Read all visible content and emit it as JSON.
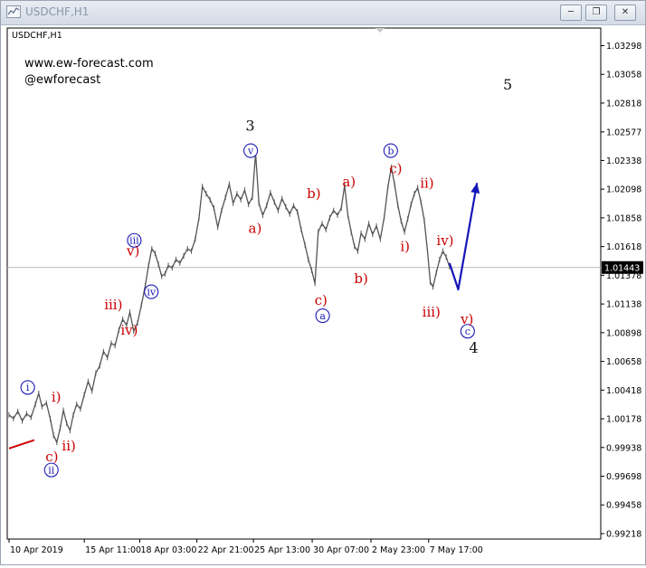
{
  "window": {
    "title": "USDCHF,H1",
    "buttons": [
      "minimize",
      "restore",
      "close"
    ]
  },
  "chart_data": {
    "type": "line",
    "symbol_label": "USDCHF,H1",
    "watermark": [
      "www.ew-forecast.com",
      "@ewforecast"
    ],
    "ylim": [
      0.9918,
      1.034
    ],
    "xlim": [
      0,
      100
    ],
    "y_ticks": [
      "1.03298",
      "1.03058",
      "1.02818",
      "1.02577",
      "1.02338",
      "1.02098",
      "1.01858",
      "1.01618",
      "1.01378",
      "1.01138",
      "1.00898",
      "1.00658",
      "1.00418",
      "1.00178",
      "0.99938",
      "0.99698",
      "0.99458",
      "0.99218"
    ],
    "y_tick_values": [
      1.03298,
      1.03058,
      1.02818,
      1.02577,
      1.02338,
      1.02098,
      1.01858,
      1.01618,
      1.01378,
      1.01138,
      1.00898,
      1.00658,
      1.00418,
      1.00178,
      0.99938,
      0.99698,
      0.99458,
      0.99218
    ],
    "x_ticks": [
      "10 Apr 2019",
      "15 Apr 11:00",
      "18 Apr 03:00",
      "22 Apr 21:00",
      "25 Apr 13:00",
      "30 Apr 07:00",
      "2 May 23:00",
      "7 May 17:00"
    ],
    "x_tick_positions": [
      0,
      13.7,
      23.8,
      34.2,
      44.5,
      55.2,
      65.9,
      76.4
    ],
    "current_price": "1.01443",
    "current_price_value": 1.01443,
    "colors": {
      "price": "#555555",
      "label_red": "#cc0000",
      "label_blue": "#1a1ab4",
      "arrow_blue": "#1616b8",
      "label_black": "#111111",
      "price_box": "#000000"
    },
    "series": [
      {
        "values": [
          [
            0,
            1.0021
          ],
          [
            0.8,
            1.0018
          ],
          [
            1.6,
            1.0024
          ],
          [
            2.4,
            1.0016
          ],
          [
            3.2,
            1.0022
          ],
          [
            4.0,
            1.0019
          ],
          [
            4.8,
            1.003
          ],
          [
            5.4,
            1.0039
          ],
          [
            6.0,
            1.0028
          ],
          [
            6.8,
            1.0031
          ],
          [
            7.5,
            1.0018
          ],
          [
            8.1,
            1.0004
          ],
          [
            8.7,
            0.9998
          ],
          [
            9.3,
            1.001
          ],
          [
            9.9,
            1.0025
          ],
          [
            10.5,
            1.0014
          ],
          [
            11.1,
            1.0008
          ],
          [
            11.7,
            1.0021
          ],
          [
            12.3,
            1.003
          ],
          [
            13.0,
            1.0026
          ],
          [
            13.7,
            1.0038
          ],
          [
            14.4,
            1.0049
          ],
          [
            15.1,
            1.0041
          ],
          [
            15.8,
            1.0056
          ],
          [
            16.5,
            1.0062
          ],
          [
            17.2,
            1.0074
          ],
          [
            17.9,
            1.0069
          ],
          [
            18.6,
            1.0081
          ],
          [
            19.3,
            1.0079
          ],
          [
            20.0,
            1.0092
          ],
          [
            20.7,
            1.0101
          ],
          [
            21.4,
            1.0096
          ],
          [
            22.0,
            1.0107
          ],
          [
            22.7,
            1.0091
          ],
          [
            23.4,
            1.0098
          ],
          [
            24.1,
            1.0113
          ],
          [
            24.8,
            1.0129
          ],
          [
            25.4,
            1.0146
          ],
          [
            26.0,
            1.016
          ],
          [
            26.6,
            1.0156
          ],
          [
            27.2,
            1.0147
          ],
          [
            27.8,
            1.0137
          ],
          [
            28.4,
            1.0139
          ],
          [
            29.0,
            1.0146
          ],
          [
            29.7,
            1.0144
          ],
          [
            30.4,
            1.0151
          ],
          [
            31.1,
            1.0148
          ],
          [
            31.8,
            1.0154
          ],
          [
            32.5,
            1.016
          ],
          [
            33.2,
            1.0158
          ],
          [
            33.9,
            1.0168
          ],
          [
            34.6,
            1.0186
          ],
          [
            35.2,
            1.0212
          ],
          [
            35.9,
            1.0206
          ],
          [
            36.6,
            1.0201
          ],
          [
            37.3,
            1.0194
          ],
          [
            38.0,
            1.0178
          ],
          [
            38.7,
            1.0192
          ],
          [
            39.4,
            1.0203
          ],
          [
            40.1,
            1.0214
          ],
          [
            40.8,
            1.0198
          ],
          [
            41.5,
            1.0206
          ],
          [
            42.2,
            1.0201
          ],
          [
            42.9,
            1.0209
          ],
          [
            43.6,
            1.0197
          ],
          [
            44.3,
            1.0203
          ],
          [
            44.9,
            1.024
          ],
          [
            45.5,
            1.0198
          ],
          [
            46.2,
            1.0188
          ],
          [
            46.9,
            1.0196
          ],
          [
            47.6,
            1.0207
          ],
          [
            48.3,
            1.0199
          ],
          [
            49.0,
            1.0192
          ],
          [
            49.7,
            1.0202
          ],
          [
            50.4,
            1.0195
          ],
          [
            51.1,
            1.0189
          ],
          [
            51.8,
            1.0196
          ],
          [
            52.5,
            1.0191
          ],
          [
            53.2,
            1.0176
          ],
          [
            53.9,
            1.0163
          ],
          [
            54.5,
            1.0151
          ],
          [
            55.1,
            1.0142
          ],
          [
            55.7,
            1.0131
          ],
          [
            56.3,
            1.0174
          ],
          [
            57.0,
            1.0181
          ],
          [
            57.7,
            1.0176
          ],
          [
            58.4,
            1.0186
          ],
          [
            59.1,
            1.0192
          ],
          [
            59.8,
            1.0188
          ],
          [
            60.5,
            1.0194
          ],
          [
            61.1,
            1.0213
          ],
          [
            61.7,
            1.0188
          ],
          [
            62.3,
            1.0174
          ],
          [
            62.9,
            1.0162
          ],
          [
            63.5,
            1.0158
          ],
          [
            64.1,
            1.0173
          ],
          [
            64.8,
            1.0168
          ],
          [
            65.5,
            1.0181
          ],
          [
            66.2,
            1.0172
          ],
          [
            66.9,
            1.0179
          ],
          [
            67.6,
            1.0168
          ],
          [
            68.3,
            1.0186
          ],
          [
            69.0,
            1.0212
          ],
          [
            69.6,
            1.0228
          ],
          [
            70.2,
            1.0214
          ],
          [
            70.8,
            1.0196
          ],
          [
            71.4,
            1.0183
          ],
          [
            72.0,
            1.0174
          ],
          [
            72.6,
            1.0185
          ],
          [
            73.2,
            1.0197
          ],
          [
            73.8,
            1.0206
          ],
          [
            74.4,
            1.0211
          ],
          [
            75.0,
            1.0199
          ],
          [
            75.6,
            1.0184
          ],
          [
            76.2,
            1.0158
          ],
          [
            76.7,
            1.0132
          ],
          [
            77.2,
            1.0128
          ],
          [
            77.8,
            1.014
          ],
          [
            78.4,
            1.0151
          ],
          [
            79.0,
            1.0158
          ],
          [
            79.6,
            1.0153
          ],
          [
            80.2,
            1.0145
          ]
        ]
      }
    ],
    "projection": {
      "points": [
        [
          80.2,
          1.0148
        ],
        [
          81.8,
          1.0126
        ],
        [
          85.2,
          1.0215
        ]
      ],
      "arrow": true
    },
    "red_trendline": [
      [
        0,
        0.9993
      ],
      [
        4.6,
        1.0
      ]
    ],
    "wave_labels": [
      {
        "text": "3",
        "x": 43.9,
        "y": 1.02625,
        "style": "black"
      },
      {
        "text": "5",
        "x": 90.8,
        "y": 1.0297,
        "style": "black"
      },
      {
        "text": "4",
        "x": 84.6,
        "y": 1.0077,
        "style": "black"
      },
      {
        "text": "v",
        "x": 44.0,
        "y": 1.0242,
        "style": "circle"
      },
      {
        "text": "iii",
        "x": 22.8,
        "y": 1.0167,
        "style": "circle"
      },
      {
        "text": "iv",
        "x": 25.9,
        "y": 1.0124,
        "style": "circle"
      },
      {
        "text": "i",
        "x": 3.4,
        "y": 1.0044,
        "style": "circle"
      },
      {
        "text": "ii",
        "x": 7.7,
        "y": 0.9975,
        "style": "circle"
      },
      {
        "text": "b",
        "x": 69.5,
        "y": 1.0242,
        "style": "circle"
      },
      {
        "text": "a",
        "x": 57.1,
        "y": 1.0104,
        "style": "circle"
      },
      {
        "text": "c",
        "x": 83.5,
        "y": 1.0091,
        "style": "circle"
      },
      {
        "text": "i)",
        "x": 8.6,
        "y": 1.0036,
        "style": "red"
      },
      {
        "text": "ii)",
        "x": 10.9,
        "y": 0.9995,
        "style": "red"
      },
      {
        "text": "c)",
        "x": 7.8,
        "y": 0.9986,
        "style": "red"
      },
      {
        "text": "iii)",
        "x": 19.0,
        "y": 1.0113,
        "style": "red"
      },
      {
        "text": "iv)",
        "x": 21.9,
        "y": 1.0092,
        "style": "red"
      },
      {
        "text": "v)",
        "x": 22.6,
        "y": 1.0158,
        "style": "red"
      },
      {
        "text": "a)",
        "x": 44.8,
        "y": 1.0177,
        "style": "red"
      },
      {
        "text": "b)",
        "x": 55.5,
        "y": 1.0206,
        "style": "red"
      },
      {
        "text": "c)",
        "x": 56.8,
        "y": 1.0117,
        "style": "red"
      },
      {
        "text": "a)",
        "x": 61.9,
        "y": 1.0216,
        "style": "red"
      },
      {
        "text": "b)",
        "x": 64.1,
        "y": 1.0135,
        "style": "red"
      },
      {
        "text": "c)",
        "x": 70.4,
        "y": 1.0227,
        "style": "red"
      },
      {
        "text": "ii)",
        "x": 76.1,
        "y": 1.0215,
        "style": "red"
      },
      {
        "text": "i)",
        "x": 72.1,
        "y": 1.0162,
        "style": "red"
      },
      {
        "text": "iv)",
        "x": 79.4,
        "y": 1.0167,
        "style": "red"
      },
      {
        "text": "iii)",
        "x": 76.9,
        "y": 1.0107,
        "style": "red"
      },
      {
        "text": "v)",
        "x": 83.4,
        "y": 1.0101,
        "style": "red"
      }
    ],
    "grid": false,
    "legend": "none"
  }
}
